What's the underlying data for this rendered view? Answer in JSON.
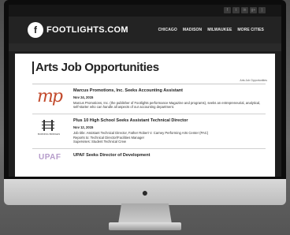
{
  "brand": {
    "logo_mark": "f",
    "name": "FOOTLIGHTS.COM"
  },
  "social_icons": [
    {
      "name": "facebook-icon",
      "glyph": "f"
    },
    {
      "name": "twitter-icon",
      "glyph": "t"
    },
    {
      "name": "linkedin-icon",
      "glyph": "in"
    },
    {
      "name": "googleplus-icon",
      "glyph": "g+"
    },
    {
      "name": "rss-icon",
      "glyph": ")"
    }
  ],
  "nav": [
    "CHICAGO",
    "MADISON",
    "MILWAUKEE",
    "MORE CITIES"
  ],
  "page": {
    "title": "Arts Job Opportunities",
    "breadcrumb": "Arts Job Opportunities"
  },
  "jobs": [
    {
      "logo": "mp",
      "title": "Marcus Promotions, Inc. Seeks Accounting Assistant",
      "date": "Nov 24, 2015",
      "desc": "Marcus Promotions, Inc. (the publisher of Footlights performance Magazine and programs), seeks an entrepreneurial, analytical, self-starter who can handle all aspects of our accounting department."
    },
    {
      "logo": "cabin",
      "logo_sub": "BURNING BRIDGES",
      "title": "Plus 10 High School Seeks Assistant Technical Director",
      "date": "Nov 12, 2015",
      "line1": "Job title: Assistant Technical Director, Father Robert V. Carney Performing Arts Center (PAC)",
      "line2": "Reports to: Technical Director/Facilities Manager",
      "line3": "Supervises: Student Technical Crew"
    },
    {
      "logo": "UPAF",
      "title": "UPAF Seeks Director of Development"
    }
  ],
  "colors": {
    "accent": "#c24a2c",
    "header_bg": "#232323",
    "bezel": "#0c0c0c"
  }
}
